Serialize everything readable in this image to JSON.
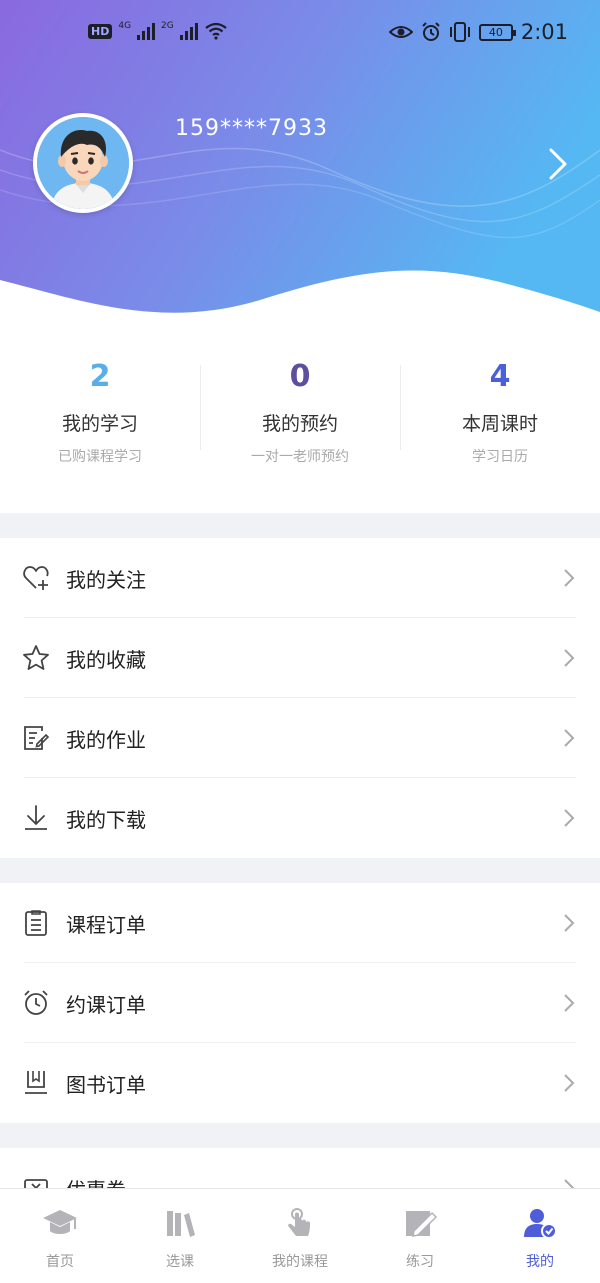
{
  "status_bar": {
    "left_badges": [
      "HD",
      "4G",
      "2G"
    ],
    "battery": "40",
    "time": "2:01"
  },
  "profile": {
    "phone": "159****7933",
    "avatar_icon": "avatar-icon",
    "arrow_icon": "chevron-right-icon"
  },
  "stats": [
    {
      "value": "2",
      "title": "我的学习",
      "subtitle": "已购课程学习",
      "color": "#5aaee8"
    },
    {
      "value": "0",
      "title": "我的预约",
      "subtitle": "一对一老师预约",
      "color": "#5d4e9e"
    },
    {
      "value": "4",
      "title": "本周课时",
      "subtitle": "学习日历",
      "color": "#4a5fd9"
    }
  ],
  "menu_group1": [
    {
      "label": "我的关注",
      "icon": "heart-plus-icon"
    },
    {
      "label": "我的收藏",
      "icon": "star-icon"
    },
    {
      "label": "我的作业",
      "icon": "homework-icon"
    },
    {
      "label": "我的下载",
      "icon": "download-icon"
    }
  ],
  "menu_group2": [
    {
      "label": "课程订单",
      "icon": "order-list-icon"
    },
    {
      "label": "约课订单",
      "icon": "alarm-clock-icon"
    },
    {
      "label": "图书订单",
      "icon": "book-icon"
    }
  ],
  "menu_group3": [
    {
      "label": "优惠券",
      "icon": "coupon-icon"
    }
  ],
  "tabbar": [
    {
      "label": "首页",
      "icon": "graduation-cap-icon",
      "active": false
    },
    {
      "label": "选课",
      "icon": "books-icon",
      "active": false
    },
    {
      "label": "我的课程",
      "icon": "hand-pointer-icon",
      "active": false
    },
    {
      "label": "练习",
      "icon": "pencil-note-icon",
      "active": false
    },
    {
      "label": "我的",
      "icon": "user-check-icon",
      "active": true
    }
  ],
  "colors": {
    "header_gradient_start": "#7d6fe0",
    "header_gradient_end": "#5ab6f3",
    "tab_active": "#4f5ed8",
    "section_gap": "#f1f2f6"
  }
}
